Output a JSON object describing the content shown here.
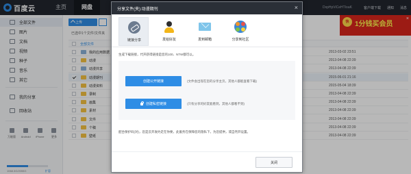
{
  "app": {
    "logo_text": "百度云",
    "colors": {
      "topbar": "#22262e",
      "accent": "#2e8de5",
      "folder": "#f5c242",
      "promo": "#d9261c"
    }
  },
  "topnav": {
    "items": [
      {
        "label": "主页",
        "active": false
      },
      {
        "label": "网盘",
        "active": true
      }
    ],
    "user_name": "DxpHpViCeHTIoaK",
    "links": [
      "客户端下载",
      "通知",
      "消息"
    ]
  },
  "promo": {
    "badge": "快",
    "title": "1分钱买会员",
    "close": "×"
  },
  "sidebar": {
    "items": [
      {
        "label": "全部文件",
        "icon": "folder-icon",
        "active": true
      },
      {
        "label": "图片",
        "icon": "image-icon",
        "active": false
      },
      {
        "label": "文档",
        "icon": "document-icon",
        "active": false
      },
      {
        "label": "视频",
        "icon": "video-icon",
        "active": false
      },
      {
        "label": "种子",
        "icon": "torrent-icon",
        "active": false
      },
      {
        "label": "音乐",
        "icon": "music-icon",
        "active": false
      },
      {
        "label": "其它",
        "icon": "other-icon",
        "active": false
      }
    ],
    "extras": [
      {
        "label": "我的分享",
        "icon": "share-icon"
      },
      {
        "label": "回收站",
        "icon": "trash-icon"
      }
    ],
    "devices": [
      "万能版",
      "Android",
      "iPhone",
      "更多"
    ],
    "quota_text": "1068.3G/2055G",
    "quota_used_fraction": 0.52,
    "quota_expand": "扩容"
  },
  "toolbar": {
    "upload_label": "上传"
  },
  "breadcrumb": "已选中1个文件/文件夹",
  "list": {
    "header_label": "全部文件",
    "rows": [
      {
        "name": "我的应用数据",
        "date": "2013-03-02 23:51",
        "type": "shared",
        "checked": false
      },
      {
        "name": "动漫",
        "date": "2013-04-08 22:39",
        "type": "folder",
        "checked": false
      },
      {
        "name": "动漫共享",
        "date": "2013-04-08 22:39",
        "type": "shared",
        "checked": false
      },
      {
        "name": "动漫期刊",
        "date": "2015-06-01 21:16",
        "type": "folder",
        "checked": true
      },
      {
        "name": "动漫资料",
        "date": "2015-05-04 18:39",
        "type": "folder",
        "checked": false
      },
      {
        "name": "录制",
        "date": "2013-04-08 22:39",
        "type": "folder",
        "checked": false
      },
      {
        "name": "画集",
        "date": "2013-04-08 22:39",
        "type": "folder",
        "checked": false
      },
      {
        "name": "素材",
        "date": "2013-04-08 22:39",
        "type": "folder",
        "checked": false
      },
      {
        "name": "文件",
        "date": "2013-04-08 22:39",
        "type": "folder",
        "checked": false
      },
      {
        "name": "个稿",
        "date": "2013-04-08 22:39",
        "type": "folder",
        "checked": false
      },
      {
        "name": "壁纸",
        "date": "2013-04-08 22:39",
        "type": "folder",
        "checked": false
      }
    ]
  },
  "dialog": {
    "title": "分享文件(夹):动漫期刊",
    "close": "×",
    "tabs": [
      {
        "label": "链接分享",
        "icon": "link-icon",
        "active": true
      },
      {
        "label": "发给好友",
        "icon": "friend-icon",
        "active": false
      },
      {
        "label": "发到邮箱",
        "icon": "mail-icon",
        "active": false
      },
      {
        "label": "分享到社区",
        "icon": "social-icon",
        "active": false
      }
    ],
    "description": "生成下载链接，代开获得链接是您的100、NTW都可以。",
    "options": [
      {
        "label": "创建公开链接",
        "desc": "(文件会出现在您的分享主页，其他人都能查看下载)",
        "lock": false
      },
      {
        "label": "创建私密链接",
        "desc": "(只有分享的好友能看到，其他人都看不到)",
        "lock": true
      }
    ],
    "note": "配合保护码(对)，您是云开发约走在你要，此服务在保障您的隐私下，为您提供，或自然开设置。",
    "close_button": "关闭"
  }
}
